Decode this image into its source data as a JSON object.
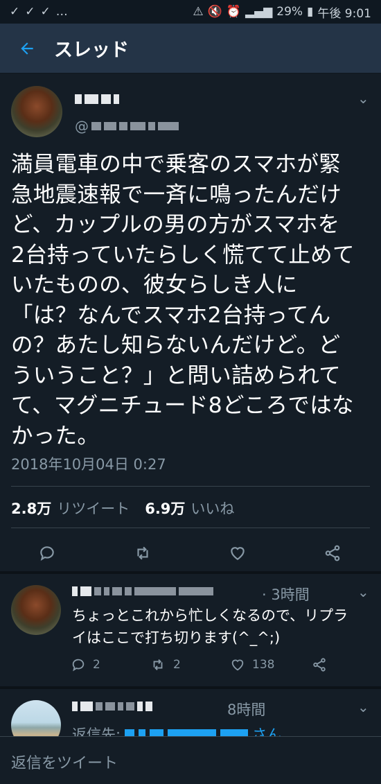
{
  "statusbar": {
    "left_icons": [
      "check-icon",
      "check-icon",
      "check-icon",
      "more-icon"
    ],
    "battery": "29%",
    "time": "午後 9:01"
  },
  "topbar": {
    "title": "スレッド",
    "accent": "#1da1f2"
  },
  "tweet": {
    "text": "満員電車の中で乗客のスマホが緊\n急地震速報で一斉に鳴ったんだけ\nど、カップルの男の方がスマホを\n2台持っていたらしく慌てて止めて\nいたものの、彼女らしき人に\n「は？なんでスマホ2台持ってん\nの？あたし知らないんだけど。ど\nういうこと？」と問い詰められて\nて、マグニチュード8どころではな\nかった。",
    "timestamp": "2018年10月04日 0:27",
    "retweets": "2.8万",
    "retweets_label": "リツイート",
    "likes": "6.9万",
    "likes_label": "いいね"
  },
  "replies": [
    {
      "time": "· 3時間",
      "text": "ちょっとこれから忙しくなるので、リプラ\nイはここで打ち切ります(^_^;)",
      "reply_count": "2",
      "retweet_count": "2",
      "like_count": "138"
    },
    {
      "time": "8時間",
      "replying_to_label": "返信先:",
      "replying_suffix": "さん"
    }
  ],
  "compose": {
    "placeholder": "返信をツイート"
  }
}
